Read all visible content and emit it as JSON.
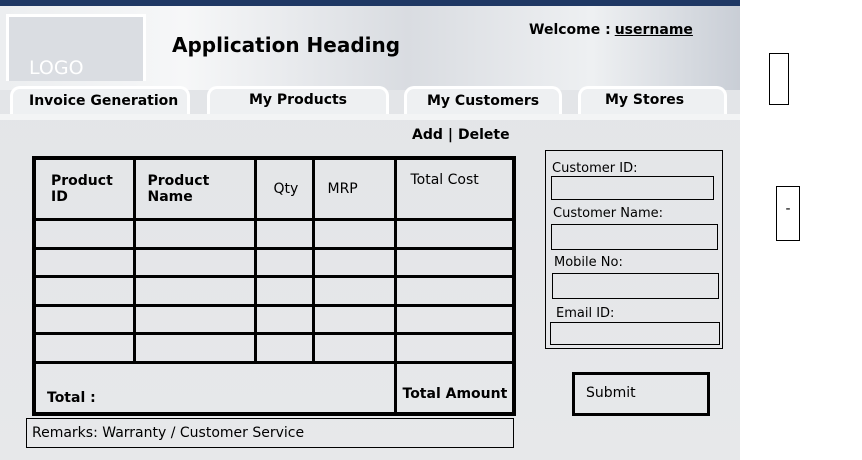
{
  "header": {
    "logo_text": "LOGO",
    "app_heading": "Application Heading",
    "welcome_label": "Welcome :",
    "username": "username"
  },
  "tabs": [
    {
      "label": "Invoice Generation"
    },
    {
      "label": "My Products"
    },
    {
      "label": "My Customers"
    },
    {
      "label": "My Stores"
    }
  ],
  "actions": {
    "add": "Add",
    "separator": "|",
    "delete": "Delete"
  },
  "table": {
    "columns": [
      "Product ID",
      "Product Name",
      "Qty",
      "MRP",
      "Total Cost"
    ],
    "row_count": 5,
    "total_label": "Total :",
    "total_amount_label": "Total Amount"
  },
  "form": {
    "customer_id_label": "Customer ID:",
    "customer_name_label": "Customer Name:",
    "mobile_label": "Mobile No:",
    "email_label": "Email ID:",
    "submit_label": "Submit"
  },
  "remarks": "Remarks: Warranty / Customer Service",
  "side": {
    "minus_label": "-"
  },
  "colors": {
    "top_bar": "#1f3864",
    "panel": "#e7e8ea"
  }
}
